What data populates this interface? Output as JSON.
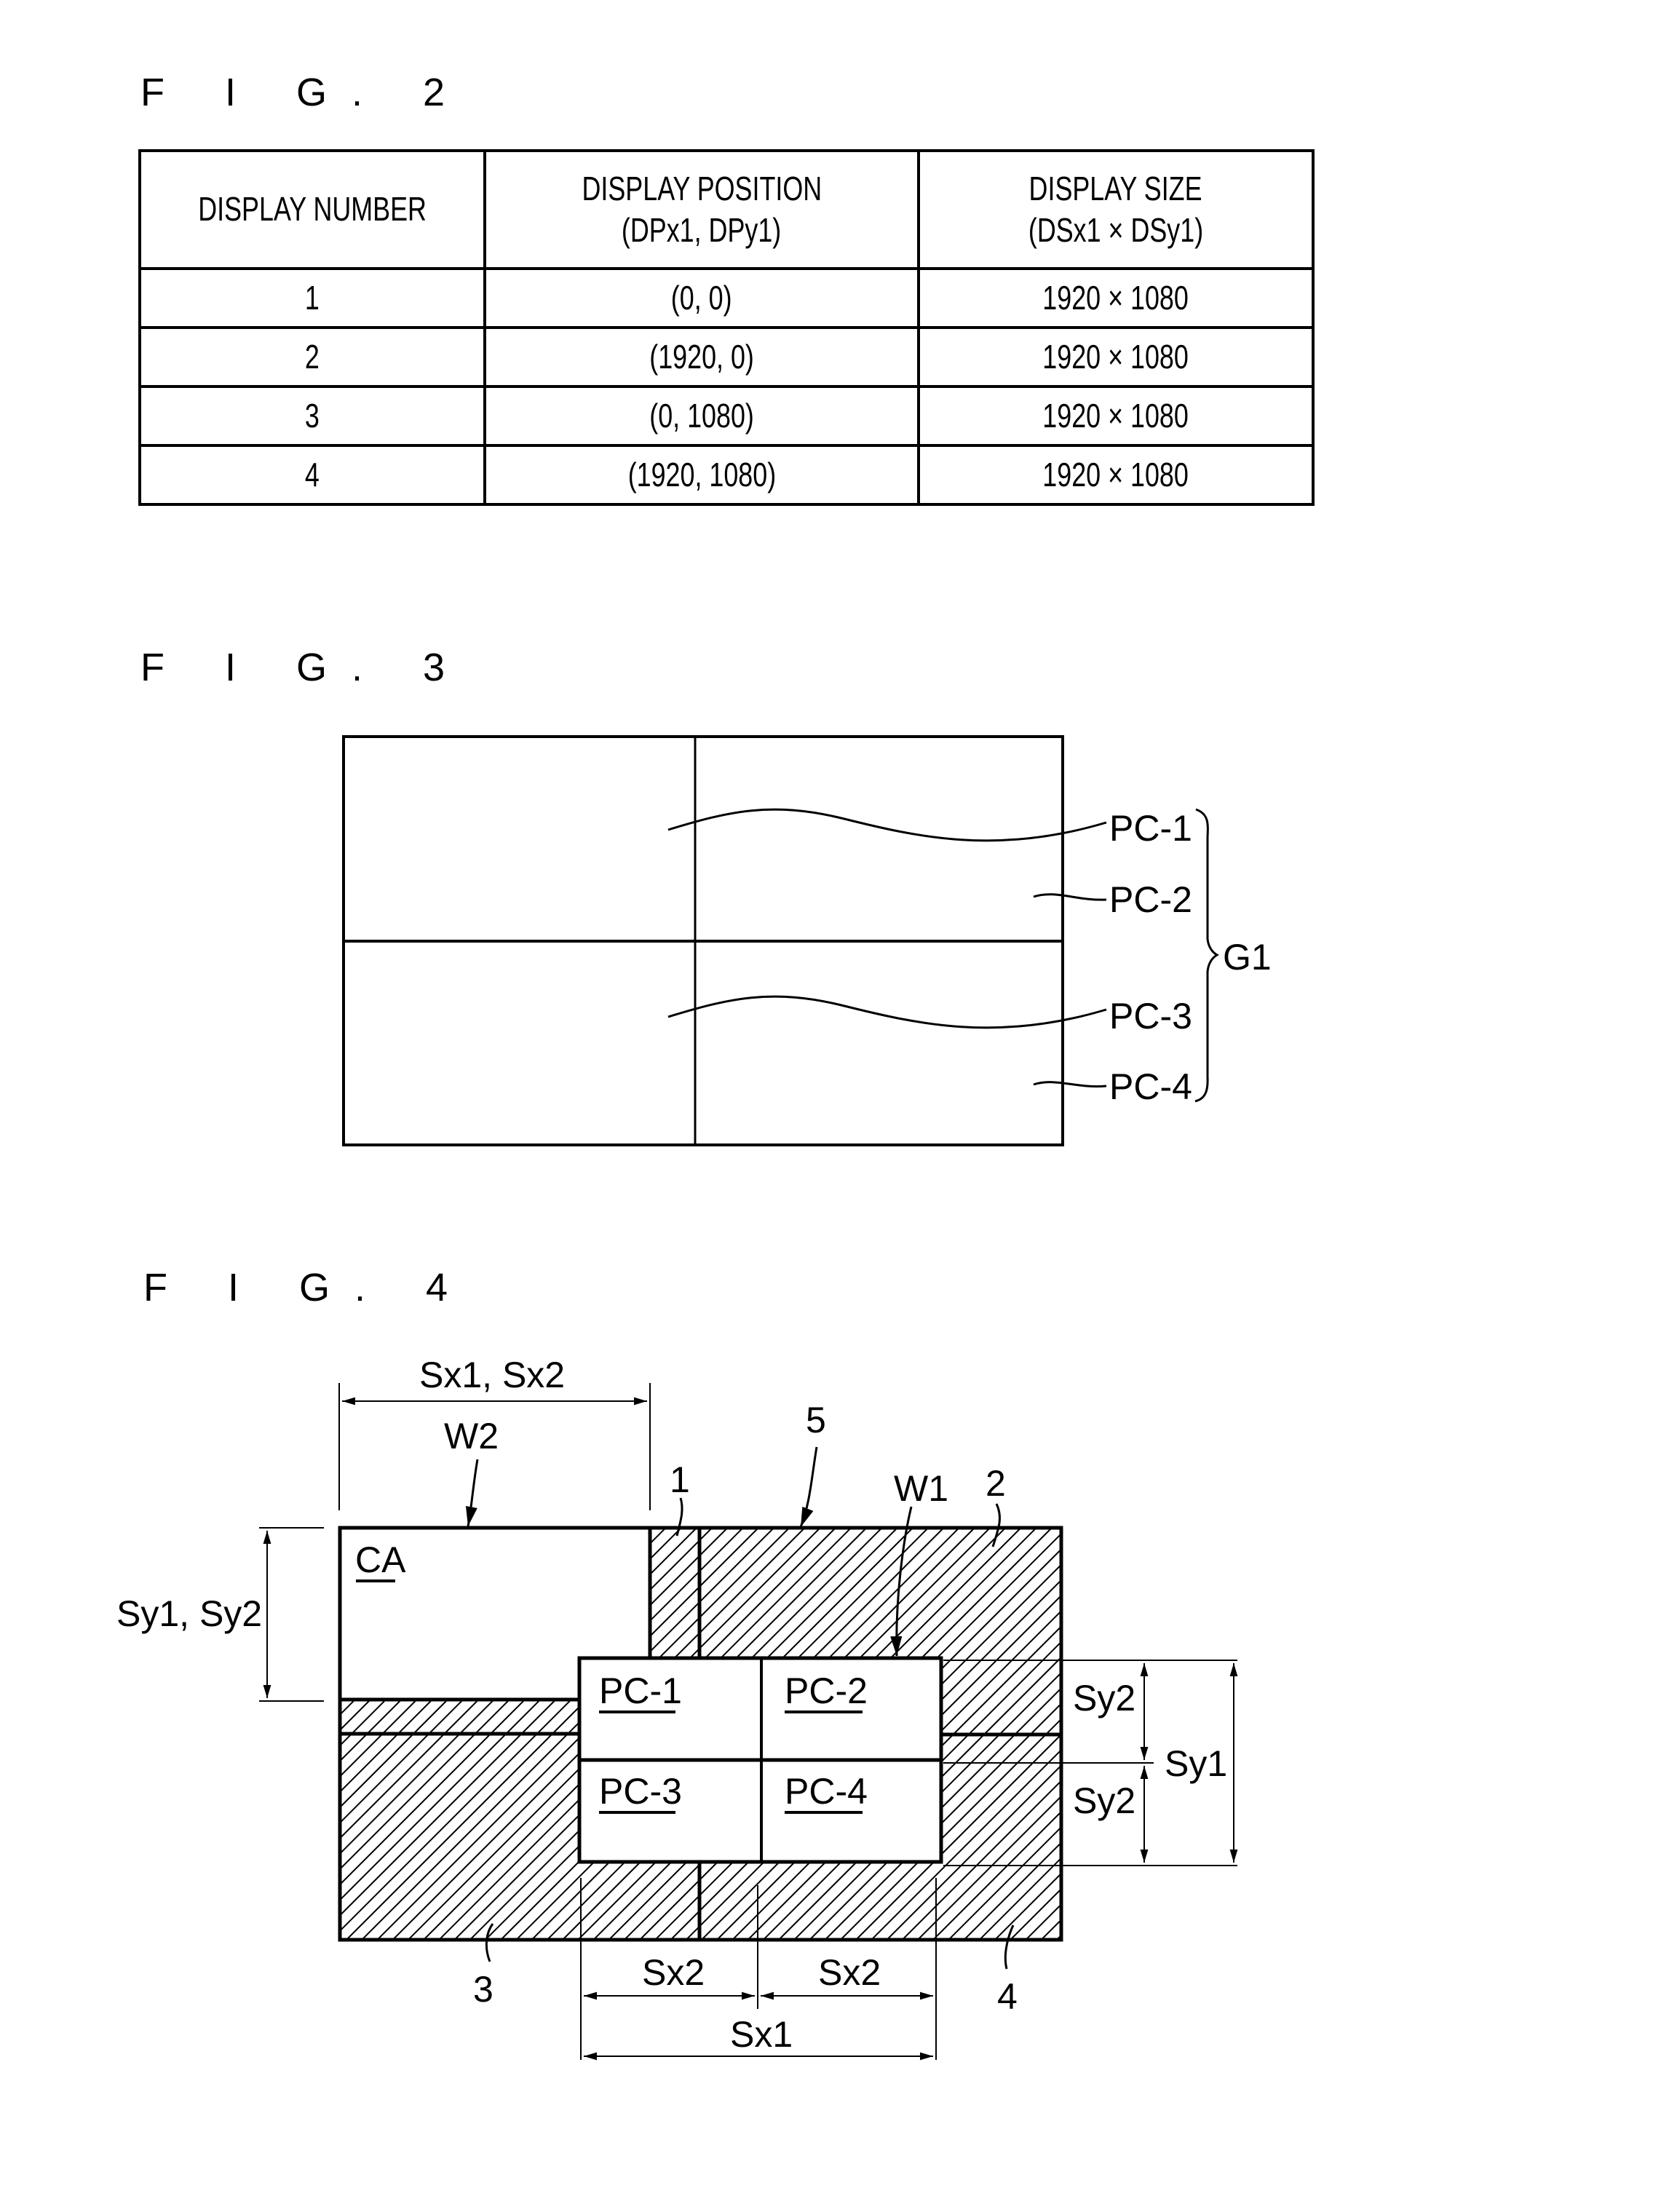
{
  "figures": {
    "fig2": {
      "label": "F I G. 2",
      "table": {
        "headers": [
          {
            "line1": "DISPLAY NUMBER",
            "line2": ""
          },
          {
            "line1": "DISPLAY POSITION",
            "line2": "(DPx1, DPy1)"
          },
          {
            "line1": "DISPLAY SIZE",
            "line2": "(DSx1 × DSy1)"
          }
        ],
        "rows": [
          {
            "number": "1",
            "position": "(0, 0)",
            "size": "1920 × 1080"
          },
          {
            "number": "2",
            "position": "(1920, 0)",
            "size": "1920 × 1080"
          },
          {
            "number": "3",
            "position": "(0, 1080)",
            "size": "1920 × 1080"
          },
          {
            "number": "4",
            "position": "(1920, 1080)",
            "size": "1920 × 1080"
          }
        ]
      }
    },
    "fig3": {
      "label": "F I G. 3",
      "callouts": [
        "PC-1",
        "PC-2",
        "PC-3",
        "PC-4"
      ],
      "group_label": "G1"
    },
    "fig4": {
      "label": "F I G. 4",
      "window_labels": {
        "w1": "W1",
        "w2": "W2",
        "content_area": "CA"
      },
      "display_refs": {
        "d1": "1",
        "d2": "2",
        "d3": "3",
        "d4": "4",
        "screen": "5"
      },
      "pane_labels": [
        "PC-1",
        "PC-2",
        "PC-3",
        "PC-4"
      ],
      "dimensions": {
        "top": "Sx1, Sx2",
        "left": "Sy1, Sy2",
        "right_upper": "Sy2",
        "right_lower": "Sy2",
        "right_total": "Sy1",
        "bottom_left": "Sx2",
        "bottom_right": "Sx2",
        "bottom_total": "Sx1"
      }
    }
  }
}
